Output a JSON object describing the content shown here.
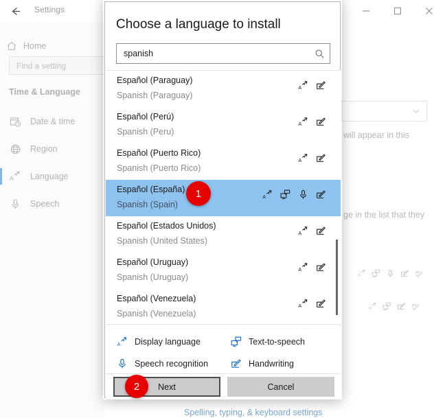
{
  "window": {
    "title": "Settings",
    "back_icon": "back-arrow-icon",
    "controls": {
      "minimize": "minimize-icon",
      "maximize": "maximize-icon",
      "close": "close-icon"
    }
  },
  "sidebar": {
    "home_label": "Home",
    "home_icon": "home-icon",
    "search_placeholder": "Find a setting",
    "group_header": "Time & Language",
    "items": [
      {
        "label": "Date & time",
        "icon": "calendar-clock-icon",
        "selected": false
      },
      {
        "label": "Region",
        "icon": "globe-icon",
        "selected": false
      },
      {
        "label": "Language",
        "icon": "display-language-icon",
        "selected": true
      },
      {
        "label": "Speech",
        "icon": "microphone-icon",
        "selected": false
      }
    ]
  },
  "background_content": {
    "dropdown_value": "",
    "dropdown_icon": "chevron-down-icon",
    "text_fragment_1": "will appear in this",
    "text_fragment_2": "ge in the list that they",
    "icon_row_1": [
      "display-language-icon",
      "text-to-speech-icon",
      "microphone-icon",
      "handwriting-icon",
      "spellcheck-icon"
    ],
    "icon_row_2": [
      "display-language-icon",
      "text-to-speech-icon",
      "handwriting-icon",
      "spellcheck-icon"
    ],
    "bottom_link": "Spelling, typing, & keyboard settings"
  },
  "dialog": {
    "title": "Choose a language to install",
    "search_value": "spanish",
    "search_placeholder": "",
    "search_icon": "search-icon",
    "languages": [
      {
        "native": "Español (Paraguay)",
        "english": "Spanish (Paraguay)",
        "icons": [
          "display-language-icon",
          "handwriting-icon"
        ],
        "selected": false
      },
      {
        "native": "Español (Perú)",
        "english": "Spanish (Peru)",
        "icons": [
          "display-language-icon",
          "handwriting-icon"
        ],
        "selected": false
      },
      {
        "native": "Español (Puerto Rico)",
        "english": "Spanish (Puerto Rico)",
        "icons": [
          "display-language-icon",
          "handwriting-icon"
        ],
        "selected": false
      },
      {
        "native": "Español (España)",
        "english": "Spanish (Spain)",
        "icons": [
          "display-language-icon",
          "text-to-speech-icon",
          "microphone-icon",
          "handwriting-icon"
        ],
        "selected": true
      },
      {
        "native": "Español (Estados Unidos)",
        "english": "Spanish (United States)",
        "icons": [
          "display-language-icon",
          "handwriting-icon"
        ],
        "selected": false
      },
      {
        "native": "Español (Uruguay)",
        "english": "Spanish (Uruguay)",
        "icons": [
          "display-language-icon",
          "handwriting-icon"
        ],
        "selected": false
      },
      {
        "native": "Español (Venezuela)",
        "english": "Spanish (Venezuela)",
        "icons": [
          "display-language-icon",
          "handwriting-icon"
        ],
        "selected": false
      }
    ],
    "legend": [
      {
        "label": "Display language",
        "icon": "display-language-icon"
      },
      {
        "label": "Text-to-speech",
        "icon": "text-to-speech-icon"
      },
      {
        "label": "Speech recognition",
        "icon": "microphone-icon"
      },
      {
        "label": "Handwriting",
        "icon": "handwriting-icon"
      }
    ],
    "buttons": {
      "next": "Next",
      "cancel": "Cancel"
    }
  },
  "annotations": [
    {
      "number": "1",
      "target": "selected-language-row"
    },
    {
      "number": "2",
      "target": "next-button"
    }
  ],
  "colors": {
    "selection_blue": "#8fc3ef",
    "legend_icon_blue": "#1b6fc4",
    "badge_red": "#e60000",
    "link_blue": "#7aa7d6",
    "nav_accent": "#7fb8e6"
  }
}
